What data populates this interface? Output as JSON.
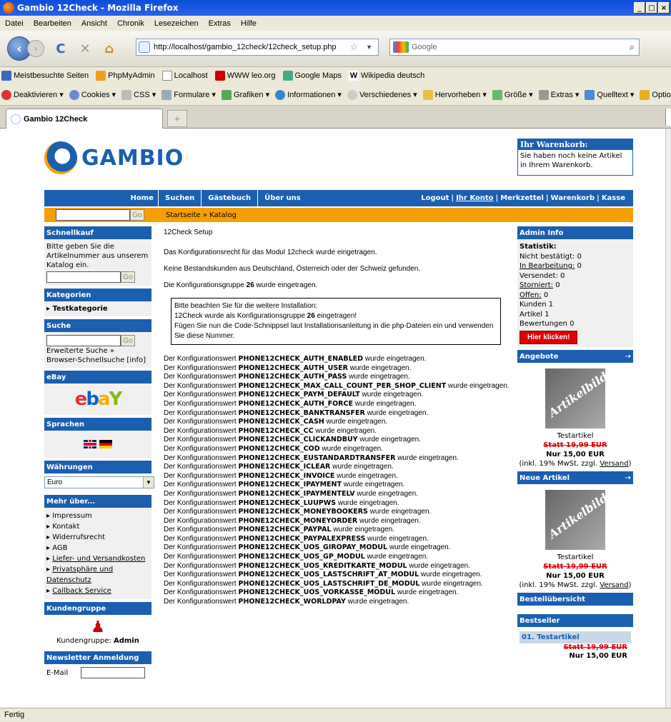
{
  "window": {
    "title": "Gambio 12Check - Mozilla Firefox"
  },
  "menu": [
    "Datei",
    "Bearbeiten",
    "Ansicht",
    "Chronik",
    "Lesezeichen",
    "Extras",
    "Hilfe"
  ],
  "url": "http://localhost/gambio_12check/12check_setup.php",
  "search_placeholder": "Google",
  "bookmarks": [
    "Meistbesuchte Seiten",
    "PhpMyAdmin",
    "Localhost",
    "WWW leo.org",
    "Google Maps",
    "Wikipedia deutsch"
  ],
  "webdev": [
    "Deaktivieren",
    "Cookies",
    "CSS",
    "Formulare",
    "Grafiken",
    "Informationen",
    "Verschiedenes",
    "Hervorheben",
    "Größe",
    "Extras",
    "Quelltext",
    "Optionen"
  ],
  "tab_title": "Gambio 12Check",
  "status": "Fertig",
  "logo": "GAMBIO",
  "cart": {
    "title": "Ihr Warenkorb:",
    "text": "Sie haben noch keine Artikel in Ihrem Warenkorb."
  },
  "topnav": {
    "home": "Home",
    "items": [
      "Suchen",
      "Gästebuch",
      "Über uns"
    ],
    "right": [
      "Logout",
      "Ihr Konto",
      "Merkzettel",
      "Warenkorb",
      "Kasse"
    ]
  },
  "breadcrumb": "Startseite » Katalog",
  "go": "Go",
  "left": {
    "schnellkauf": {
      "title": "Schnellkauf",
      "text": "Bitte geben Sie die Artikelnummer aus unserem Katalog ein."
    },
    "kategorien": {
      "title": "Kategorien",
      "item": "Testkategorie"
    },
    "suche": {
      "title": "Suche",
      "ext": "Erweiterte Suche »",
      "browser": "Browser-Schnellsuche [info]"
    },
    "ebay": {
      "title": "eBay"
    },
    "sprachen": {
      "title": "Sprachen"
    },
    "waehrungen": {
      "title": "Währungen",
      "selected": "Euro"
    },
    "mehr": {
      "title": "Mehr über...",
      "items": [
        "Impressum",
        "Kontakt",
        "Widerrufsrecht",
        "AGB",
        "Liefer- und Versandkosten",
        "Privatsphäre und Datenschutz",
        "Callback Service"
      ]
    },
    "kundengruppe": {
      "title": "Kundengruppe",
      "label": "Kundengruppe:",
      "value": "Admin"
    },
    "newsletter": {
      "title": "Newsletter Anmeldung",
      "email": "E-Mail"
    }
  },
  "content": {
    "title": "12Check Setup",
    "p1": "Das Konfigurationsrecht für das Modul 12check wurde eingetragen.",
    "p2": "Keine Bestandskunden aus Deutschland, Österreich oder der Schweiz gefunden.",
    "p3a": "Die Konfigurationsgruppe ",
    "group": "26",
    "p3b": " wurde eingetragen.",
    "box1": "Bitte beachten Sie für die weitere Installation:",
    "box2a": "12Check wurde als Konfigurationsgruppe ",
    "box2b": " eingetragen!",
    "box3": "Fügen Sie nun die Code-Schnippsel laut Installationsanleitung in die php-Dateien ein und verwenden Sie diese Nummer.",
    "cfg_prefix": "Der Konfigurationswert ",
    "cfg_suffix": " wurde eingetragen.",
    "cfg": [
      "PHONE12CHECK_AUTH_ENABLED",
      "PHONE12CHECK_AUTH_USER",
      "PHONE12CHECK_AUTH_PASS",
      "PHONE12CHECK_MAX_CALL_COUNT_PER_SHOP_CLIENT",
      "PHONE12CHECK_PAYM_DEFAULT",
      "PHONE12CHECK_AUTH_FORCE",
      "PHONE12CHECK_BANKTRANSFER",
      "PHONE12CHECK_CASH",
      "PHONE12CHECK_CC",
      "PHONE12CHECK_CLICKANDBUY",
      "PHONE12CHECK_COD",
      "PHONE12CHECK_EUSTANDARDTRANSFER",
      "PHONE12CHECK_ICLEAR",
      "PHONE12CHECK_INVOICE",
      "PHONE12CHECK_IPAYMENT",
      "PHONE12CHECK_IPAYMENTELV",
      "PHONE12CHECK_LUUPWS",
      "PHONE12CHECK_MONEYBOOKERS",
      "PHONE12CHECK_MONEYORDER",
      "PHONE12CHECK_PAYPAL",
      "PHONE12CHECK_PAYPALEXPRESS",
      "PHONE12CHECK_UOS_GIROPAY_MODUL",
      "PHONE12CHECK_UOS_GP_MODUL",
      "PHONE12CHECK_UOS_KREDITKARTE_MODUL",
      "PHONE12CHECK_UOS_LASTSCHRIFT_AT_MODUL",
      "PHONE12CHECK_UOS_LASTSCHRIFT_DE_MODUL",
      "PHONE12CHECK_UOS_VORKASSE_MODUL",
      "PHONE12CHECK_WORLDPAY"
    ]
  },
  "right": {
    "admin": {
      "title": "Admin Info",
      "stat": "Statistik:",
      "rows": [
        {
          "label": "Nicht bestätigt:",
          "val": "0",
          "u": false
        },
        {
          "label": "In Bearbeitung:",
          "val": "0",
          "u": true
        },
        {
          "label": "Versendet:",
          "val": "0",
          "u": false
        },
        {
          "label": "Storniert:",
          "val": "0",
          "u": true
        },
        {
          "label": "Offen:",
          "val": "0",
          "u": true
        },
        {
          "label": "Kunden",
          "val": "1",
          "u": false
        },
        {
          "label": "Artikel",
          "val": "1",
          "u": false
        },
        {
          "label": "Bewertungen",
          "val": "0",
          "u": false
        }
      ],
      "button": "Hier klicken!"
    },
    "angebote": {
      "title": "Angebote",
      "img": "Artikelbild",
      "name": "Testartikel",
      "old": "Statt 19,99 EUR",
      "new": "Nur 15,00 EUR",
      "tax": "(inkl. 19% MwSt. zzgl. ",
      "versand": "Versand",
      "close": ")"
    },
    "neue": {
      "title": "Neue Artikel"
    },
    "bestell": {
      "title": "Bestellübersicht"
    },
    "best": {
      "title": "Bestseller",
      "item": "01. Testartikel",
      "old": "Statt 19,99 EUR",
      "new": "Nur 15,00 EUR"
    }
  },
  "colors": {
    "brand": "#1a5fb0",
    "accent": "#f5a000",
    "alert": "#dd0000"
  }
}
